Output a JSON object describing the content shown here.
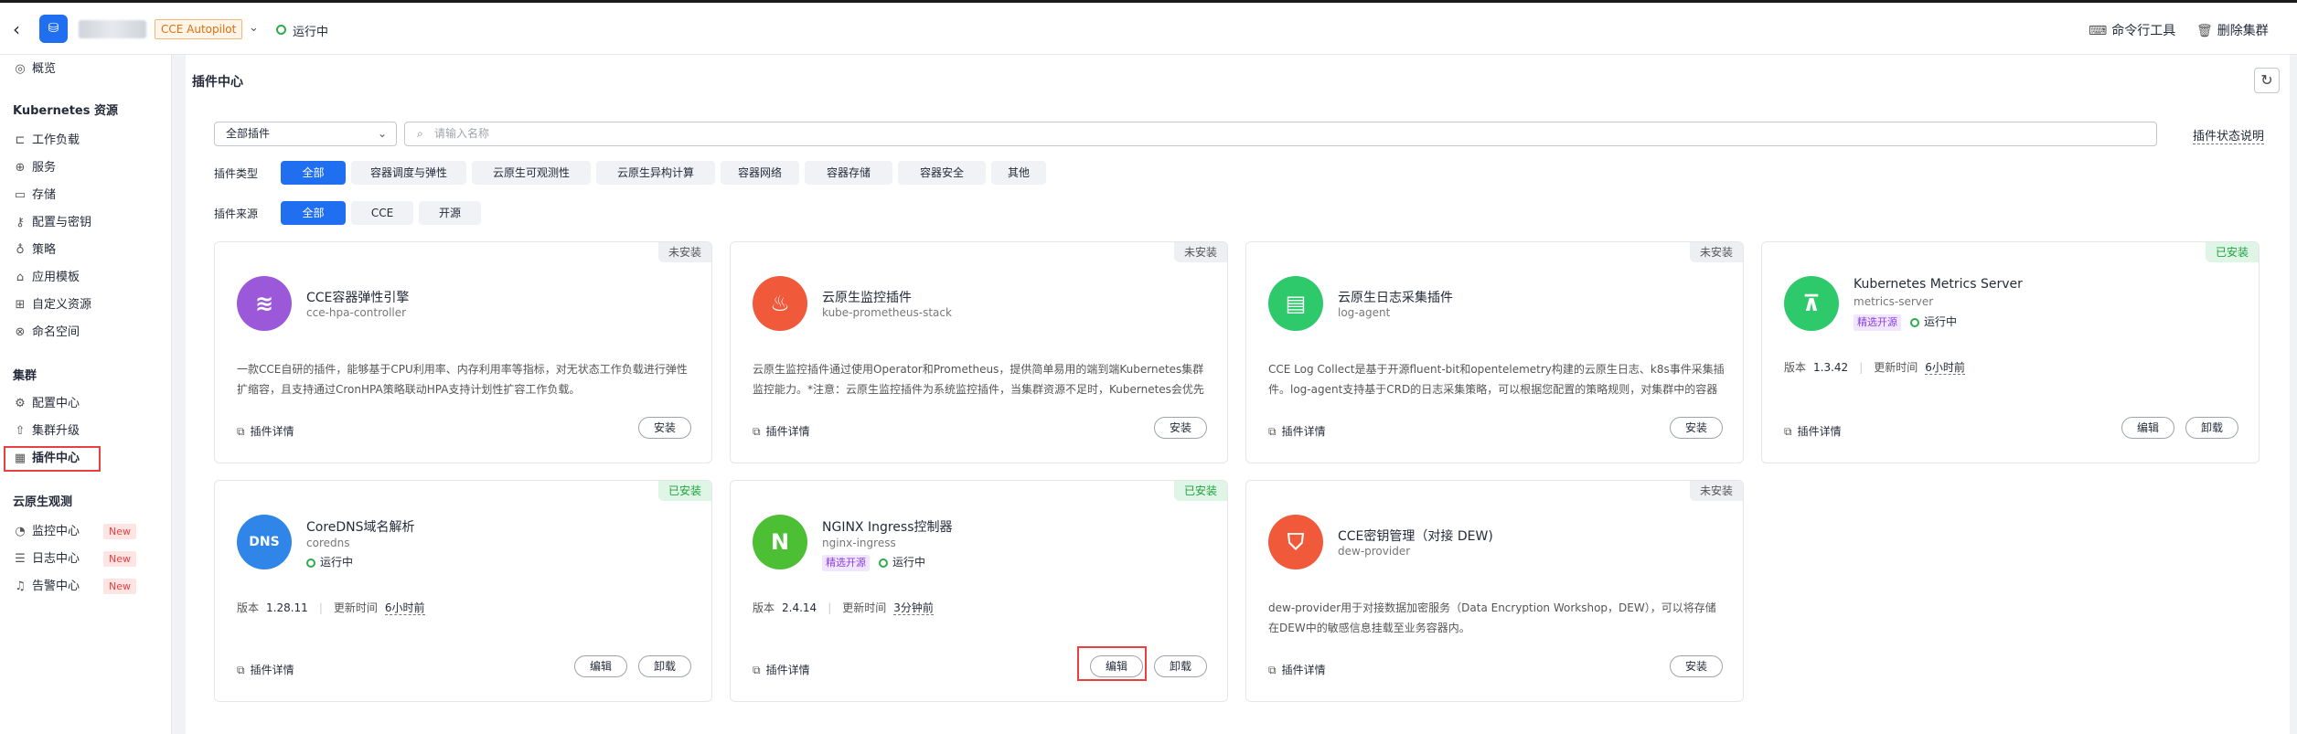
{
  "header": {
    "back_icon": "chevron-left-icon",
    "logo_icon": "cce-cluster-icon",
    "cluster_type": "CCE Autopilot",
    "status": "运行中",
    "command_tool": "命令行工具",
    "delete_cluster": "删除集群"
  },
  "sidebar": {
    "overview": "概览",
    "k8s_title": "Kubernetes 资源",
    "k8s_items": [
      "工作负载",
      "服务",
      "存储",
      "配置与密钥",
      "策略",
      "应用模板",
      "自定义资源",
      "命名空间"
    ],
    "cluster_title": "集群",
    "cluster_items": [
      "配置中心",
      "集群升级",
      "插件中心"
    ],
    "observe_title": "云原生观测",
    "observe_items": [
      "监控中心",
      "日志中心",
      "告警中心"
    ],
    "new_badge": "New"
  },
  "page": {
    "title": "插件中心",
    "select_value": "全部插件",
    "search_placeholder": "请输入名称",
    "status_help": "插件状态说明",
    "type_label": "插件类型",
    "types": [
      "全部",
      "容器调度与弹性",
      "云原生可观测性",
      "云原生异构计算",
      "容器网络",
      "容器存储",
      "容器安全",
      "其他"
    ],
    "source_label": "插件来源",
    "sources": [
      "全部",
      "CCE",
      "开源"
    ]
  },
  "labels": {
    "detail": "插件详情",
    "install": "安装",
    "edit": "编辑",
    "uninstall": "卸载",
    "version": "版本",
    "updated": "更新时间",
    "running": "运行中",
    "pick": "精选开源"
  },
  "cards": [
    {
      "name": "CCE容器弹性引擎",
      "id": "cce-hpa-controller",
      "state": "未安装",
      "installed": false,
      "color": "#9b59d9",
      "desc": "一款CCE自研的插件，能够基于CPU利用率、内存利用率等指标，对无状态工作负载进行弹性扩缩容，且支持通过CronHPA策略联动HPA支持计划性扩容工作负载。"
    },
    {
      "name": "云原生监控插件",
      "id": "kube-prometheus-stack",
      "state": "未安装",
      "installed": false,
      "color": "#f0593a",
      "desc": "云原生监控插件通过使用Operator和Prometheus，提供简单易用的端到端Kubernetes集群监控能力。*注意：云原生监控插件为系统监控插件，当集群资源不足时，Kubernetes会优先保"
    },
    {
      "name": "云原生日志采集插件",
      "id": "log-agent",
      "state": "未安装",
      "installed": false,
      "color": "#2ec96a",
      "desc": "CCE Log Collect是基于开源fluent-bit和opentelemetry构建的云原生日志、k8s事件采集插件。log-agent支持基于CRD的日志采集策略，可以根据您配置的策略规则，对集群中的容器标准"
    },
    {
      "name": "Kubernetes Metrics Server",
      "id": "metrics-server",
      "state": "已安装",
      "installed": true,
      "pick": true,
      "color": "#2ec96a",
      "version": "1.3.42",
      "updated": "6小时前"
    },
    {
      "name": "CoreDNS域名解析",
      "id": "coredns",
      "state": "已安装",
      "installed": true,
      "pick": false,
      "color": "#2f86e8",
      "version": "1.28.11",
      "updated": "6小时前"
    },
    {
      "name": "NGINX Ingress控制器",
      "id": "nginx-ingress",
      "state": "已安装",
      "installed": true,
      "pick": true,
      "color": "#4cbf34",
      "version": "2.4.14",
      "updated": "3分钟前"
    },
    {
      "name": "CCE密钥管理（对接 DEW)",
      "id": "dew-provider",
      "state": "未安装",
      "installed": false,
      "color": "#f0593a",
      "desc": "dew-provider用于对接数据加密服务（Data Encryption Workshop，DEW），可以将存储在DEW中的敏感信息挂载至业务容器内。"
    }
  ]
}
